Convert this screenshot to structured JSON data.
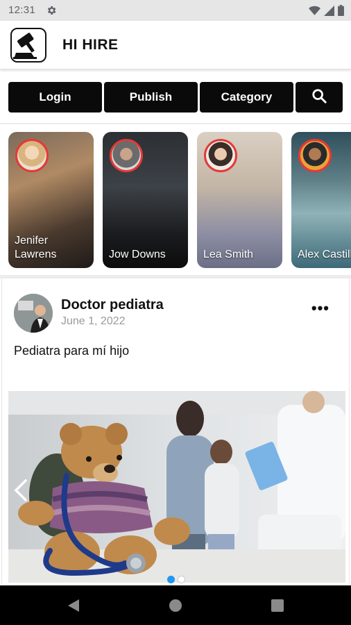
{
  "status_bar": {
    "time": "12:31",
    "icons": [
      "gear-icon",
      "wifi-icon",
      "signal-icon",
      "battery-icon"
    ]
  },
  "app_bar": {
    "title": "HI HIRE",
    "logo": "gavel-logo"
  },
  "actions": {
    "login": "Login",
    "publish": "Publish",
    "category": "Category",
    "search_icon": "search-icon"
  },
  "stories": [
    {
      "name": "Jenifer Lawrens",
      "line1": "Jenifer",
      "line2": "Lawrens"
    },
    {
      "name": "Jow Downs",
      "line1": "Jow Downs",
      "line2": ""
    },
    {
      "name": "Lea Smith",
      "line1": "Lea Smith",
      "line2": ""
    },
    {
      "name": "Alex Castillo",
      "line1": "Alex Castillo",
      "line2": ""
    }
  ],
  "post": {
    "author": "Doctor pediatra",
    "date": "June 1, 2022",
    "text": "Pediatra para mí hijo",
    "more_icon": "more-horizontal-icon",
    "carousel": {
      "current": 1,
      "total": 2
    }
  },
  "colors": {
    "button_bg": "#0a0a0a",
    "story_ring": "#e53935",
    "carousel_dot_active": "#2196f3",
    "date_gray": "#9a9a9a"
  }
}
